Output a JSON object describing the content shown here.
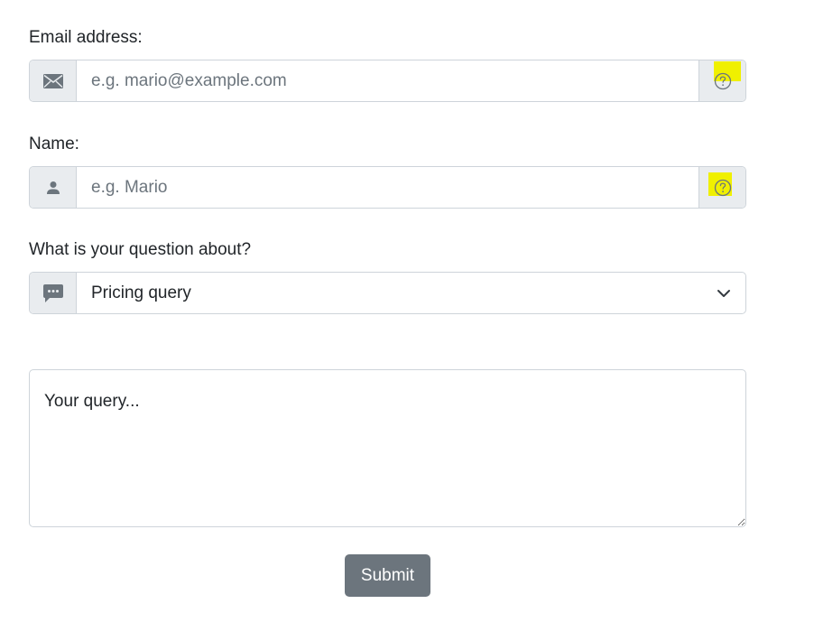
{
  "form": {
    "email": {
      "label": "Email address:",
      "placeholder": "e.g. mario@example.com",
      "value": "",
      "left_icon": "envelope-icon",
      "right_icon": "question-circle-icon"
    },
    "name": {
      "label": "Name:",
      "placeholder": "e.g. Mario",
      "value": "",
      "left_icon": "person-icon",
      "right_icon": "question-circle-icon"
    },
    "topic": {
      "label": "What is your question about?",
      "selected": "Pricing query",
      "left_icon": "chat-dots-icon",
      "right_icon": "chevron-down-icon"
    },
    "query": {
      "placeholder": "Your query..."
    },
    "submit_label": "Submit"
  },
  "colors": {
    "addon_bg": "#e9ecef",
    "border": "#ced4da",
    "button_bg": "#6c757d",
    "highlight": "#f0f000",
    "icon": "#6c757d"
  }
}
